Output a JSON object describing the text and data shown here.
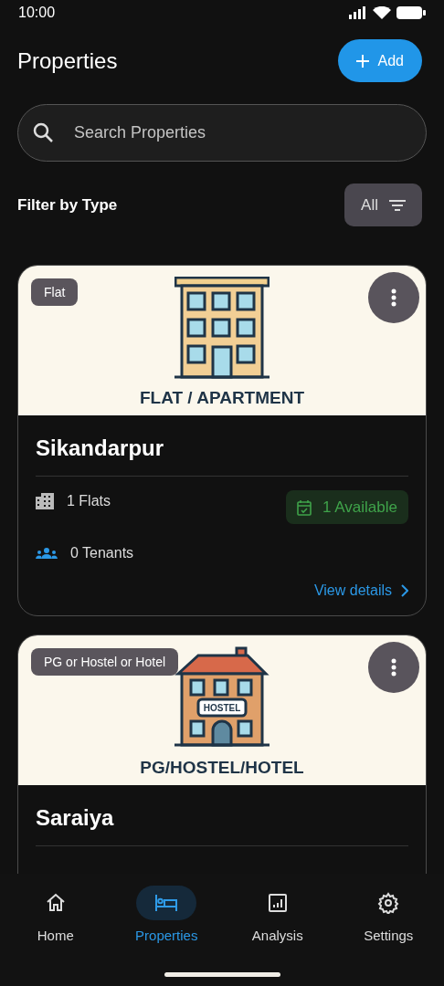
{
  "status_bar": {
    "time": "10:00"
  },
  "header": {
    "title": "Properties",
    "add_button": "Add"
  },
  "search": {
    "placeholder": "Search Properties"
  },
  "filter": {
    "label": "Filter by Type",
    "value": "All"
  },
  "properties": [
    {
      "kind": "flat",
      "type_tag": "Flat",
      "image_caption": "FLAT / APARTMENT",
      "name": "Sikandarpur",
      "units": "1 Flats",
      "tenants": "0 Tenants",
      "availability": "1 Available",
      "link": "View details"
    },
    {
      "kind": "hostel",
      "type_tag": "PG or Hostel or Hotel",
      "image_caption": "PG/HOSTEL/HOTEL",
      "image_sign": "HOSTEL",
      "name": "Saraiya"
    }
  ],
  "nav": [
    {
      "kind": "home",
      "label": "Home",
      "selected": false
    },
    {
      "kind": "bed",
      "label": "Properties",
      "selected": true
    },
    {
      "kind": "chart",
      "label": "Analysis",
      "selected": false
    },
    {
      "kind": "gear",
      "label": "Settings",
      "selected": false
    }
  ]
}
